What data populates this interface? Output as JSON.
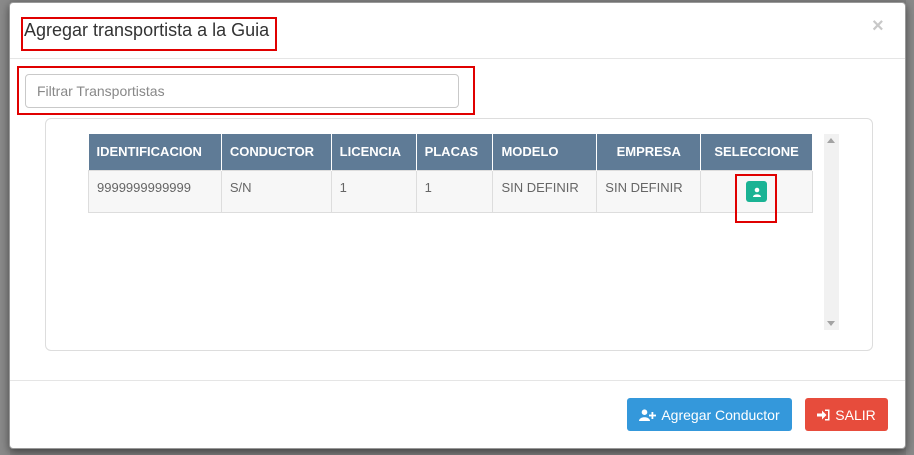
{
  "modal": {
    "title": "Agregar transportista a la Guia",
    "close_label": "×"
  },
  "filter": {
    "placeholder": "Filtrar Transportistas",
    "value": ""
  },
  "table": {
    "headers": [
      "IDENTIFICACION",
      "CONDUCTOR",
      "LICENCIA",
      "PLACAS",
      "MODELO",
      "EMPRESA",
      "SELECCIONE"
    ],
    "rows": [
      [
        "9999999999999",
        "S/N",
        "1",
        "1",
        "SIN DEFINIR",
        "SIN DEFINIR"
      ]
    ]
  },
  "footer": {
    "add_driver_label": "Agregar Conductor",
    "exit_label": "SALIR"
  },
  "icons": {
    "select": "user-icon",
    "add_driver": "user-plus-icon",
    "exit": "sign-in-icon"
  },
  "colors": {
    "header_bg": "#5f7b96",
    "select_btn": "#1ab394",
    "primary": "#3498db",
    "danger": "#e74c3c",
    "highlight": "#e00000"
  }
}
